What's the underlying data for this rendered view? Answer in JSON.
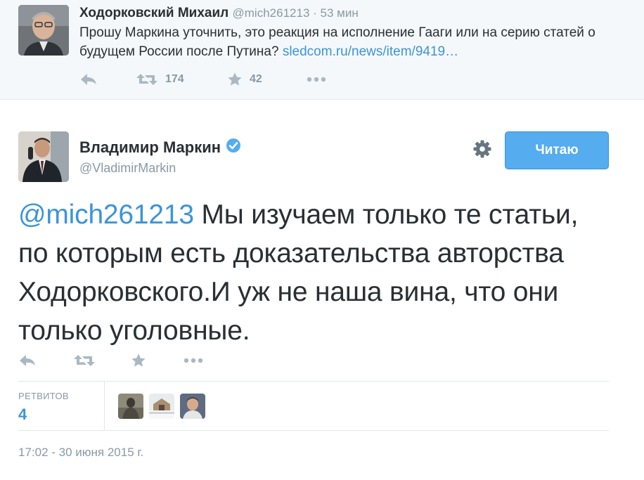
{
  "parent_tweet": {
    "name": "Ходорковский Михаил",
    "handle": "@mich261213",
    "separator": " · ",
    "time": "53 мин",
    "text": "Прошу Маркина уточнить, это реакция на исполнение Гааги или на серию статей о будущем России после Путина? ",
    "link": "sledcom.ru/news/item/9419…",
    "retweet_count": "174",
    "favorite_count": "42"
  },
  "main_tweet": {
    "name": "Владимир Маркин",
    "handle": "@VladimirMarkin",
    "follow_label": "Читаю",
    "mention": "@mich261213",
    "text": " Мы изучаем только те статьи, по которым есть доказательства авторства Ходорковского.И уж не наша вина, что они только уголовные.",
    "retweets_label": "РЕТВИТОВ",
    "retweets_count": "4",
    "timestamp": "17:02 - 30 июня 2015 г."
  },
  "icons": [
    "reply-icon",
    "retweet-icon",
    "favorite-icon",
    "more-icon",
    "gear-icon",
    "verified-badge-icon"
  ],
  "colors": {
    "link": "#3b94d9",
    "button": "#55acee",
    "muted": "#8899a6",
    "action_icon": "#aab8c2",
    "parent_bg": "#f5f8fa"
  }
}
